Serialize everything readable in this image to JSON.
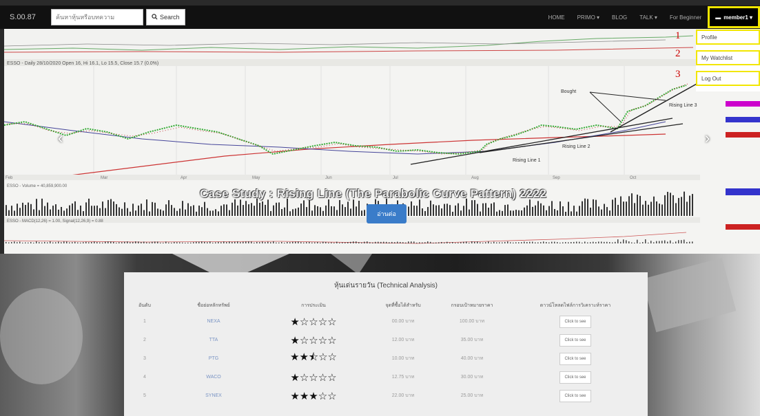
{
  "navbar": {
    "brand": "S.00.87",
    "search_placeholder": "ค้นหาหุ้นหรือบทความ",
    "search_label": "Search",
    "links": [
      "HOME",
      "PRIMO ▾",
      "BLOG",
      "TALK ▾",
      "For Beginner"
    ],
    "user_label": "member1 ▾"
  },
  "dropdown": {
    "items": [
      "Profile",
      "My Watchlist",
      "Log Out"
    ],
    "numbers": [
      "1",
      "2",
      "3"
    ]
  },
  "hero": {
    "chart_header": "ESSO - Daily 28/10/2020 Open 16, Hi 16.1, Lo 15.5, Close 15.7 (0.0%)",
    "annotations": [
      "Bought",
      "Rising Line 3",
      "Rising Line 2",
      "Rising Line 1"
    ],
    "months": [
      "Feb",
      "Mar",
      "Apr",
      "May",
      "Jun",
      "Jul",
      "Aug",
      "Sep",
      "Oct"
    ],
    "title": "Case Study : Rising Line (The Parabolic Curve Pattern) 2222",
    "read_label": "อ่านต่อ",
    "volume_label": "ESSO - Volume = 40,859,900.00",
    "macd_label": "ESSO - MACD(12,26) = 1.00, Signal(12,26,9) = 0.88"
  },
  "table": {
    "title": "หุ้นเด่นรายวัน (Technical Analysis)",
    "headers": [
      "อันดับ",
      "ชื่อย่อหลักทรัพย์",
      "การประเมิน",
      "จุดที่ซื้อได้สำหรับ",
      "กรอบเป้าหมายราคา",
      "ดาวน์โหลดไฟล์การวิเคราะห์ราคา"
    ],
    "rows": [
      {
        "rank": "1",
        "symbol": "NEXA",
        "stars": "★☆☆☆☆",
        "buy": "00.00 บาท",
        "target": "100.00 บาท",
        "action": "Click to see"
      },
      {
        "rank": "2",
        "symbol": "TTA",
        "stars": "★☆☆☆☆",
        "buy": "12.00 บาท",
        "target": "35.00 บาท",
        "action": "Click to see"
      },
      {
        "rank": "3",
        "symbol": "PTG",
        "stars": "★★⯪☆☆",
        "buy": "10.00 บาท",
        "target": "40.00 บาท",
        "action": "Click to see"
      },
      {
        "rank": "4",
        "symbol": "WACO",
        "stars": "★☆☆☆☆",
        "buy": "12.75 บาท",
        "target": "30.00 บาท",
        "action": "Click to see"
      },
      {
        "rank": "5",
        "symbol": "SYNEX",
        "stars": "★★★☆☆",
        "buy": "22.00 บาท",
        "target": "25.00 บาท",
        "action": "Click to see"
      }
    ]
  },
  "colors": {
    "highlight": "#f2e600",
    "button_blue": "#3a7cc9",
    "navbar": "#111111",
    "link_blue": "#7a94c4"
  }
}
